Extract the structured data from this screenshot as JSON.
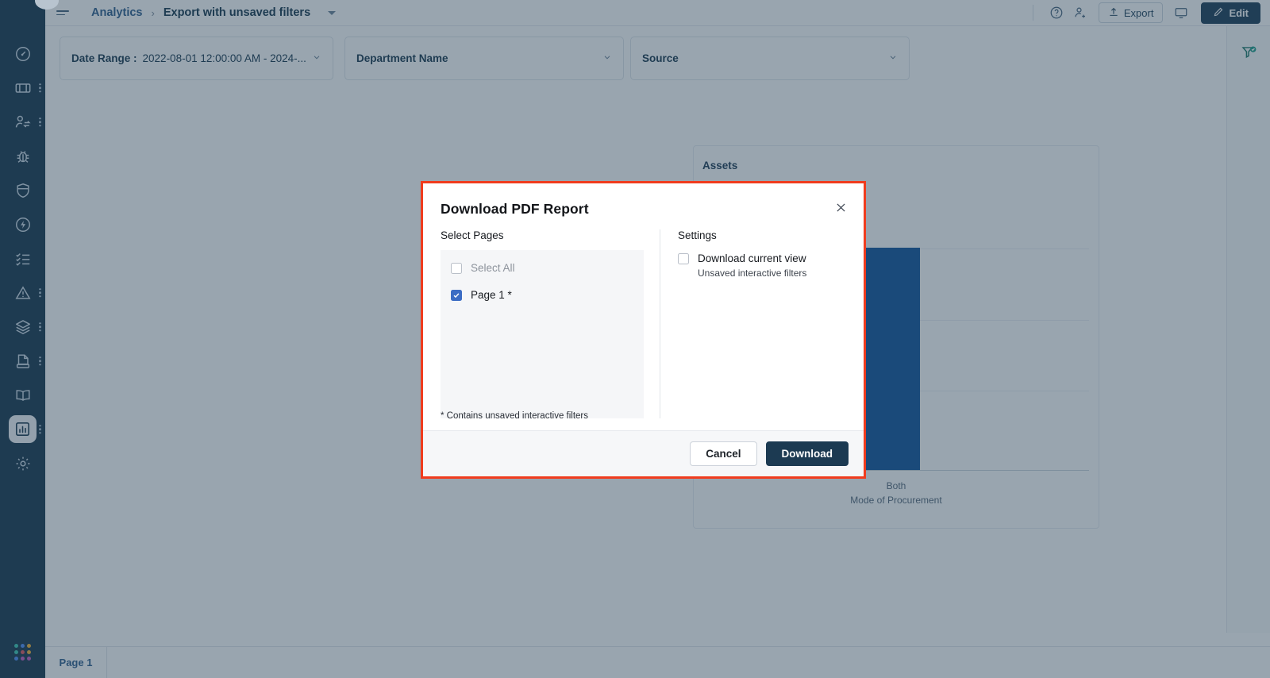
{
  "sidebar": {
    "items": [
      {
        "icon": "gauge-icon",
        "name": "sidebar-item-dashboard",
        "menu": false
      },
      {
        "icon": "ticket-icon",
        "name": "sidebar-item-tickets",
        "menu": true
      },
      {
        "icon": "user-swap-icon",
        "name": "sidebar-item-requests",
        "menu": true
      },
      {
        "icon": "bug-icon",
        "name": "sidebar-item-problems",
        "menu": false
      },
      {
        "icon": "shield-icon",
        "name": "sidebar-item-security",
        "menu": false
      },
      {
        "icon": "bolt-circle-icon",
        "name": "sidebar-item-changes",
        "menu": false
      },
      {
        "icon": "checklist-icon",
        "name": "sidebar-item-tasks",
        "menu": false
      },
      {
        "icon": "warning-triangle-icon",
        "name": "sidebar-item-alerts",
        "menu": true
      },
      {
        "icon": "layers-icon",
        "name": "sidebar-item-assets",
        "menu": true
      },
      {
        "icon": "document-scan-icon",
        "name": "sidebar-item-contracts",
        "menu": true
      },
      {
        "icon": "book-icon",
        "name": "sidebar-item-knowledge",
        "menu": false
      },
      {
        "icon": "bar-chart-icon",
        "name": "sidebar-item-analytics",
        "menu": true,
        "active": true
      },
      {
        "icon": "gear-icon",
        "name": "sidebar-item-settings",
        "menu": false
      }
    ],
    "app_grid_icon": "app-grid-icon",
    "app_grid_colors": [
      "#3ec9b4",
      "#4f8ef7",
      "#f2b134",
      "#3ec9b4",
      "#e0575f",
      "#f2b134",
      "#4f8ef7",
      "#c45ec0",
      "#c45ec0"
    ]
  },
  "topbar": {
    "menu_icon": "hamburger-menu-icon",
    "breadcrumb_root": "Analytics",
    "breadcrumb_separator": "›",
    "breadcrumb_current": "Export with unsaved filters",
    "dropdown_icon": "chevron-down-icon",
    "help_icon": "help-circle-icon",
    "add_user_icon": "add-user-icon",
    "export_label": "Export",
    "export_icon": "upload-icon",
    "present_icon": "monitor-icon",
    "edit_label": "Edit",
    "edit_icon": "pencil-icon"
  },
  "filters": [
    {
      "name": "filter-date-range",
      "label": "Date Range :",
      "value": "2022-08-01 12:00:00 AM - 2024-...",
      "chevron": "chevron-down-icon"
    },
    {
      "name": "filter-department-name",
      "label": "Department Name",
      "value": "",
      "chevron": "chevron-down-icon"
    },
    {
      "name": "filter-source",
      "label": "Source",
      "value": "",
      "chevron": "chevron-down-icon"
    }
  ],
  "right_rail": {
    "filter_applied_icon": "filter-check-icon"
  },
  "tabs": [
    {
      "name": "page-tab-1",
      "label": "Page 1",
      "active": true
    }
  ],
  "chart_data": {
    "type": "bar",
    "title": "Assets",
    "categories": [
      "Both"
    ],
    "values": [
      3
    ],
    "data_labels": [
      "3"
    ],
    "xlabel": "Mode of Procurement",
    "ylabel": "",
    "ylim": [
      0,
      4
    ],
    "grid": true,
    "legend": false,
    "bar_color": "#10549c"
  },
  "modal": {
    "title": "Download PDF Report",
    "close_icon": "close-icon",
    "select_pages_label": "Select Pages",
    "settings_label": "Settings",
    "pages": [
      {
        "name": "checkbox-select-all",
        "label": "Select All",
        "checked": false,
        "muted": true
      },
      {
        "name": "checkbox-page-1",
        "label": "Page 1 *",
        "checked": true,
        "muted": false
      }
    ],
    "settings": [
      {
        "name": "checkbox-download-current-view",
        "label": "Download current view",
        "sublabel": "Unsaved interactive filters",
        "checked": false
      }
    ],
    "footnote": "* Contains unsaved interactive filters",
    "cancel_label": "Cancel",
    "download_label": "Download",
    "highlight_color": "#f03c1e"
  }
}
